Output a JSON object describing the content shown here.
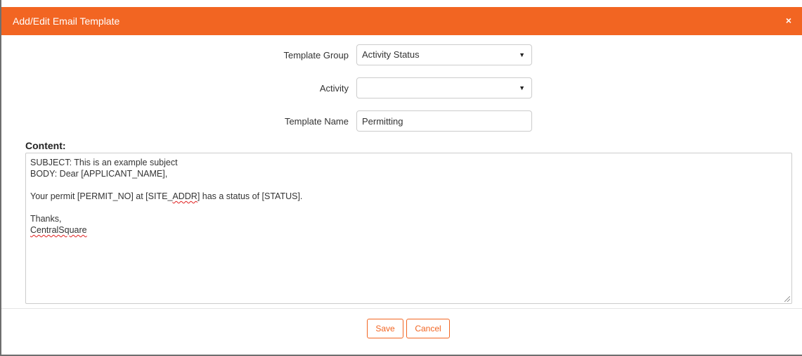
{
  "dialog": {
    "title": "Add/Edit Email Template",
    "close_glyph": "×"
  },
  "form": {
    "template_group": {
      "label": "Template Group",
      "value": "Activity Status"
    },
    "activity": {
      "label": "Activity",
      "value": ""
    },
    "template_name": {
      "label": "Template Name",
      "value": "Permitting"
    }
  },
  "content": {
    "label": "Content:",
    "lines": {
      "subject": "SUBJECT: This is an example subject",
      "body": "BODY: Dear [APPLICANT_NAME],",
      "blank1": "",
      "permit_before": "Your permit [PERMIT_NO] at [SITE",
      "permit_underscore": "_",
      "permit_misspelled": "ADDR",
      "permit_after": "] has a status of [STATUS].",
      "blank2": "",
      "thanks": "Thanks,",
      "signature": "CentralSquare"
    }
  },
  "footer": {
    "save_label": "Save",
    "cancel_label": "Cancel"
  },
  "icons": {
    "select_arrow": "▼"
  },
  "colors": {
    "accent": "#f26522",
    "text": "#333333",
    "border": "#cccccc"
  }
}
